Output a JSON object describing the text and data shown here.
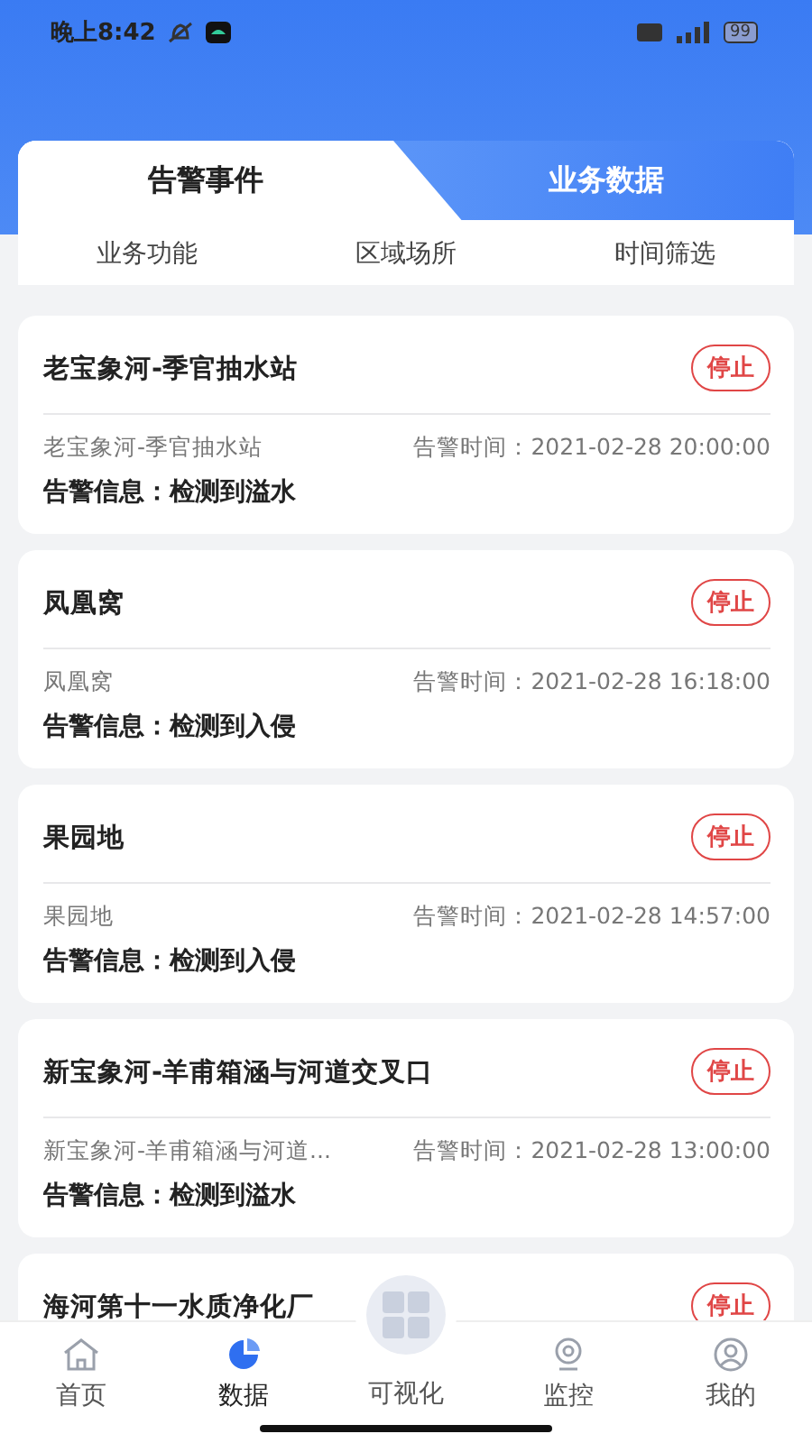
{
  "status_bar": {
    "time": "晚上8:42",
    "battery": "99"
  },
  "tabs": [
    {
      "label": "告警事件",
      "selected": true
    },
    {
      "label": "业务数据",
      "selected": false
    }
  ],
  "filters": [
    "业务功能",
    "区域场所",
    "时间筛选"
  ],
  "alarms": [
    {
      "title": "老宝象河-季官抽水站",
      "action": "停止",
      "place": "老宝象河-季官抽水站",
      "time": "告警时间：2021-02-28 20:00:00",
      "info": "告警信息：检测到溢水"
    },
    {
      "title": "凤凰窝",
      "action": "停止",
      "place": "凤凰窝",
      "time": "告警时间：2021-02-28 16:18:00",
      "info": "告警信息：检测到入侵"
    },
    {
      "title": "果园地",
      "action": "停止",
      "place": "果园地",
      "time": "告警时间：2021-02-28 14:57:00",
      "info": "告警信息：检测到入侵"
    },
    {
      "title": "新宝象河-羊甫箱涵与河道交叉口",
      "action": "停止",
      "place": "新宝象河-羊甫箱涵与河道...",
      "time": "告警时间：2021-02-28 13:00:00",
      "info": "告警信息：检测到溢水"
    },
    {
      "title": "海河第十一水质净化厂",
      "action": "停止"
    }
  ],
  "nav": [
    {
      "kind": "home",
      "label": "首页",
      "selected": false
    },
    {
      "kind": "pie",
      "label": "数据",
      "selected": true
    },
    {
      "kind": "grid",
      "label": "可视化",
      "selected": false
    },
    {
      "kind": "camera",
      "label": "监控",
      "selected": false
    },
    {
      "kind": "user",
      "label": "我的",
      "selected": false
    }
  ]
}
